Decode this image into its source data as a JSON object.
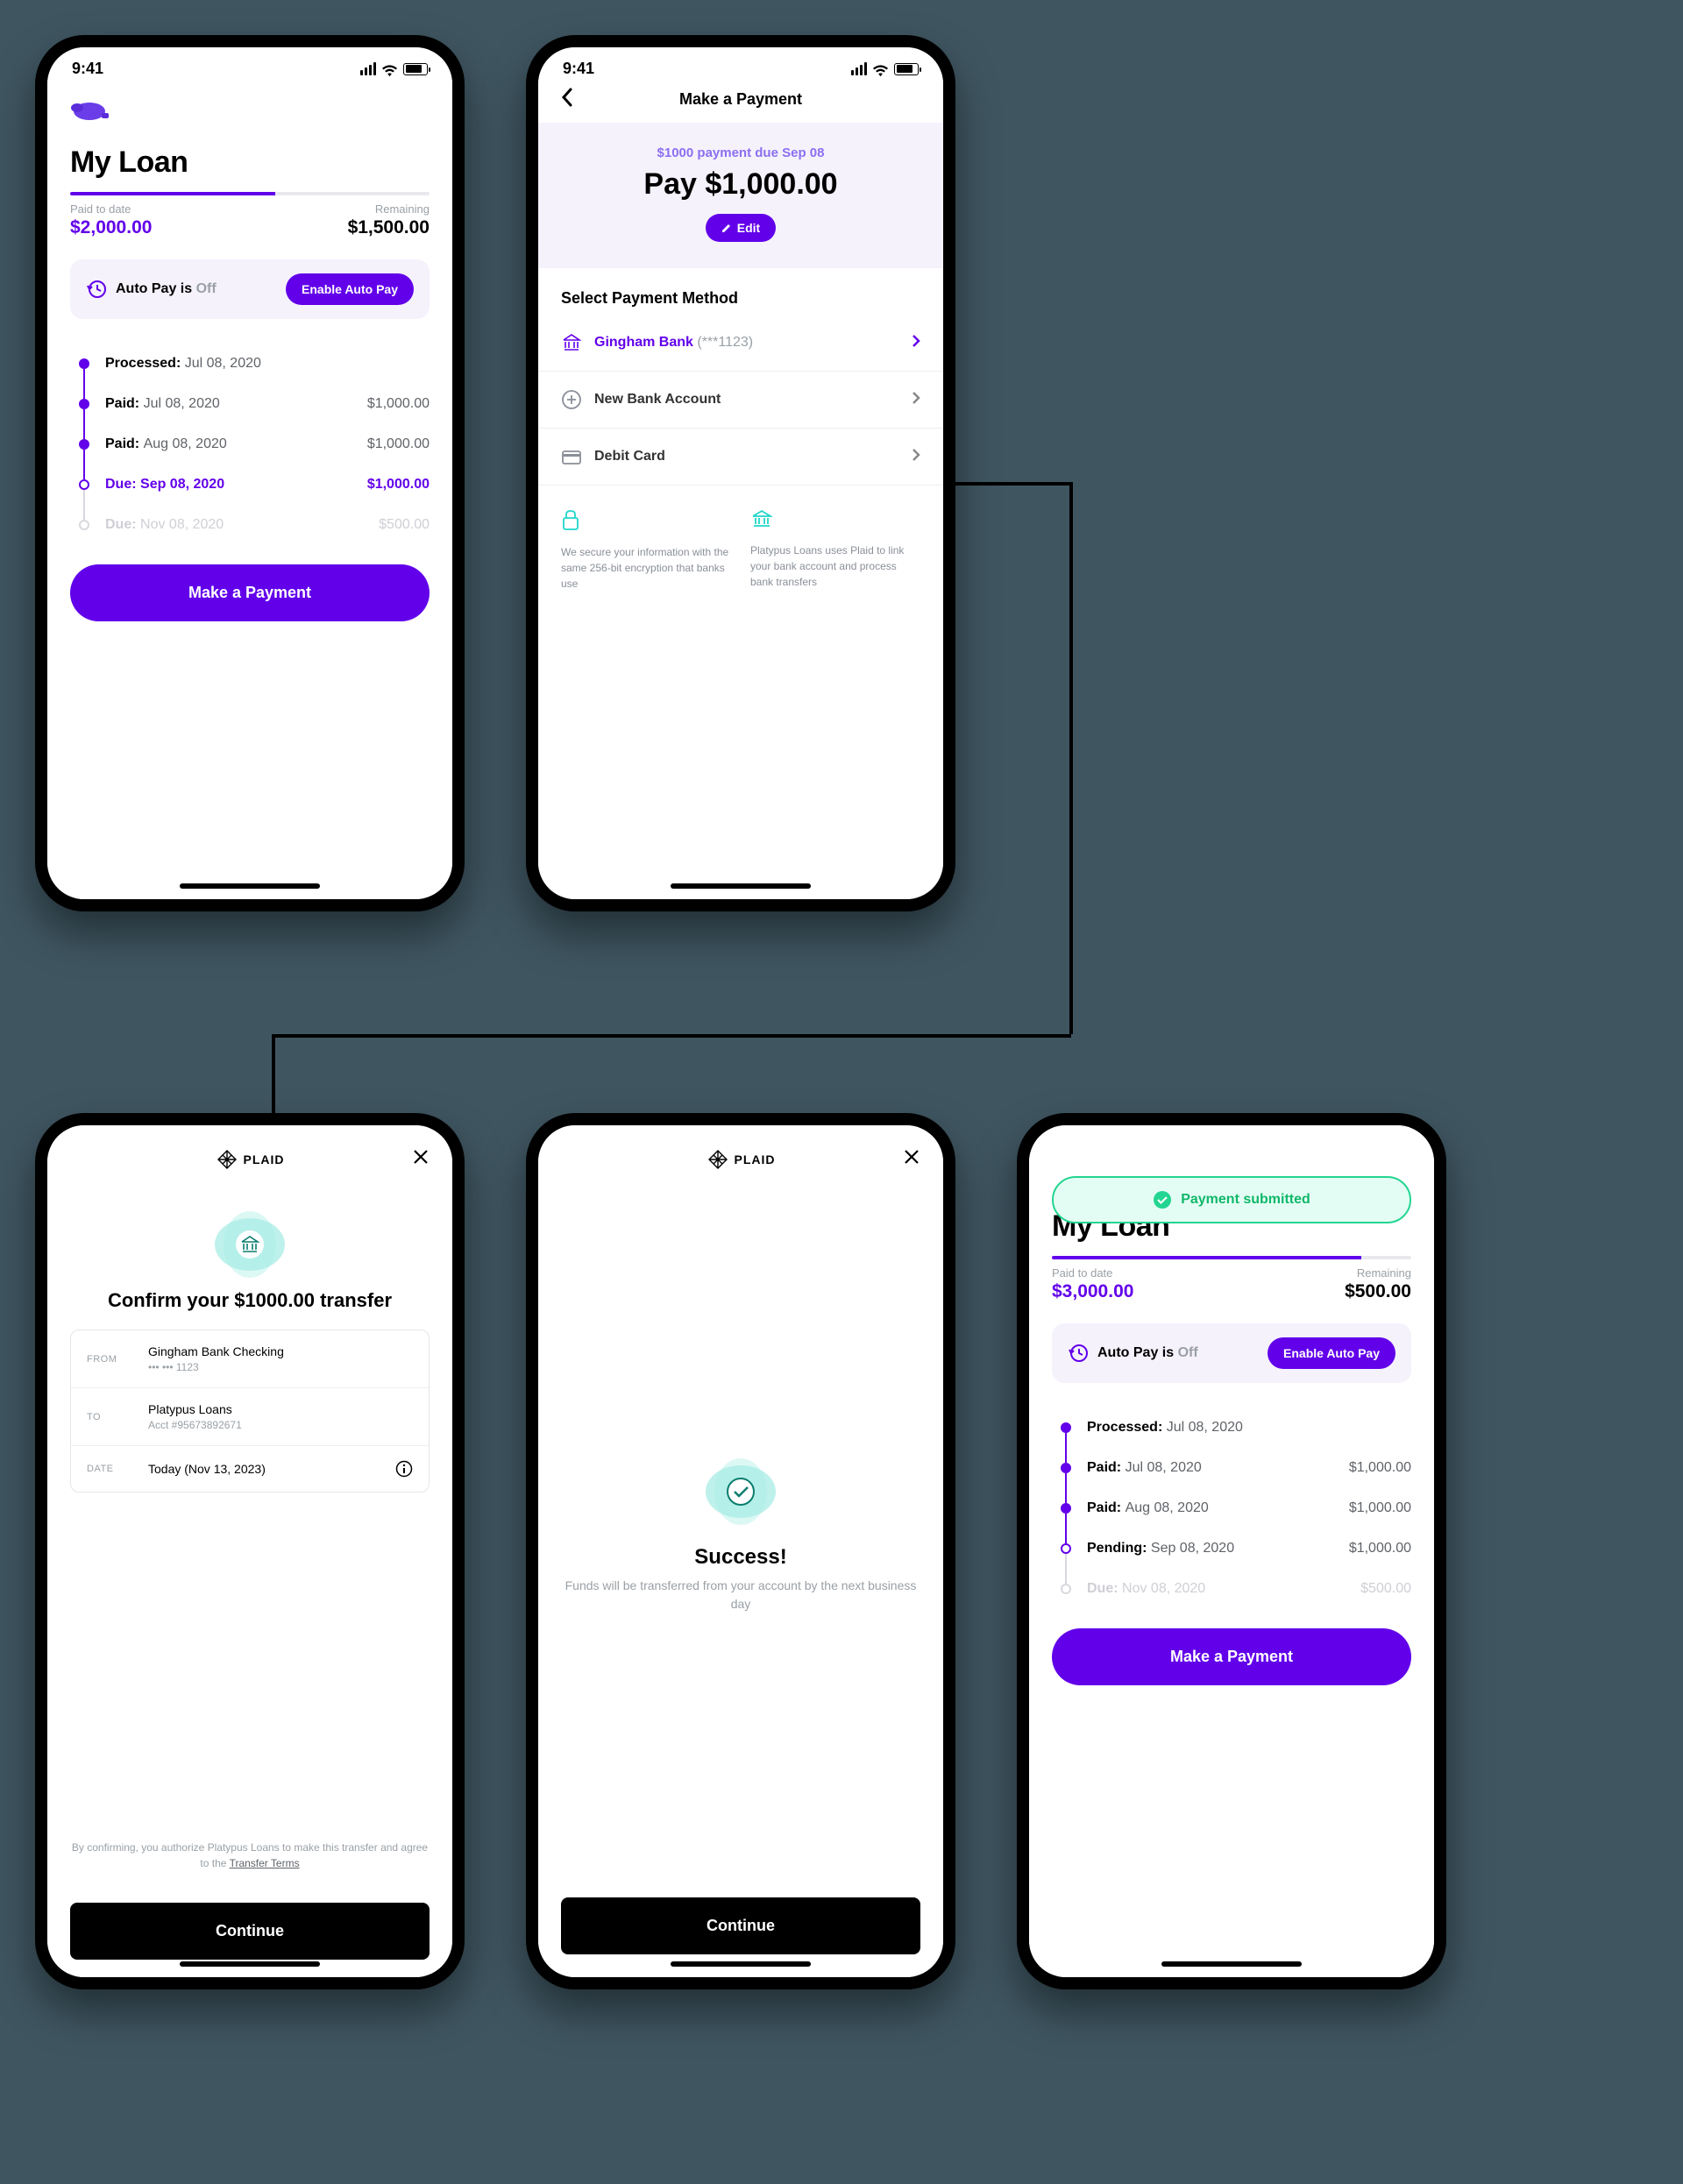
{
  "status": {
    "time": "9:41"
  },
  "screen1": {
    "title": "My Loan",
    "paid_label": "Paid to date",
    "paid_amount": "$2,000.00",
    "remaining_label": "Remaining",
    "remaining_amount": "$1,500.00",
    "progress_pct": "57%",
    "autopay_prefix": "Auto Pay is ",
    "autopay_state": "Off",
    "enable_autopay": "Enable Auto Pay",
    "items": [
      {
        "label": "Processed:",
        "date": "Jul 08, 2020",
        "amount": ""
      },
      {
        "label": "Paid:",
        "date": "Jul 08, 2020",
        "amount": "$1,000.00"
      },
      {
        "label": "Paid:",
        "date": "Aug 08, 2020",
        "amount": "$1,000.00"
      },
      {
        "label": "Due:",
        "date": "Sep 08, 2020",
        "amount": "$1,000.00"
      },
      {
        "label": "Due:",
        "date": "Nov 08, 2020",
        "amount": "$500.00"
      }
    ],
    "cta": "Make a Payment"
  },
  "screen2": {
    "title": "Make a Payment",
    "due_line": "$1000 payment due Sep 08",
    "pay_amount": "Pay $1,000.00",
    "edit": "Edit",
    "select_h": "Select Payment Method",
    "pm1_name": "Gingham Bank",
    "pm1_mask": "(***1123)",
    "pm2_name": "New Bank Account",
    "pm3_name": "Debit Card",
    "info1": "We secure your information with the same 256-bit encryption that banks use",
    "info2": "Platypus Loans uses Plaid to link your bank account and process bank transfers"
  },
  "screen3": {
    "brand": "PLAID",
    "headline": "Confirm your $1000.00 transfer",
    "from_k": "FROM",
    "from_v": "Gingham Bank Checking",
    "from_mask": "••• ••• 1123",
    "to_k": "TO",
    "to_v": "Platypus Loans",
    "to_sub": "Acct #95673892671",
    "date_k": "DATE",
    "date_v": "Today (Nov 13, 2023)",
    "disclaimer_pre": "By confirming, you authorize Platypus Loans to make this transfer and agree to the ",
    "disclaimer_link": "Transfer Terms",
    "cta": "Continue"
  },
  "screen4": {
    "brand": "PLAID",
    "headline": "Success!",
    "body": "Funds will be transferred from your account by the next business day",
    "cta": "Continue"
  },
  "screen5": {
    "toast": "Payment submitted",
    "title": "My Loan",
    "paid_label": "Paid to date",
    "paid_amount": "$3,000.00",
    "remaining_label": "Remaining",
    "remaining_amount": "$500.00",
    "progress_pct": "86%",
    "autopay_prefix": "Auto Pay is ",
    "autopay_state": "Off",
    "enable_autopay": "Enable Auto Pay",
    "items": [
      {
        "label": "Processed:",
        "date": "Jul 08, 2020",
        "amount": ""
      },
      {
        "label": "Paid:",
        "date": "Jul 08, 2020",
        "amount": "$1,000.00"
      },
      {
        "label": "Paid:",
        "date": "Aug 08, 2020",
        "amount": "$1,000.00"
      },
      {
        "label": "Pending:",
        "date": "Sep 08, 2020",
        "amount": "$1,000.00"
      },
      {
        "label": "Due:",
        "date": "Nov 08, 2020",
        "amount": "$500.00"
      }
    ],
    "cta": "Make a Payment"
  }
}
